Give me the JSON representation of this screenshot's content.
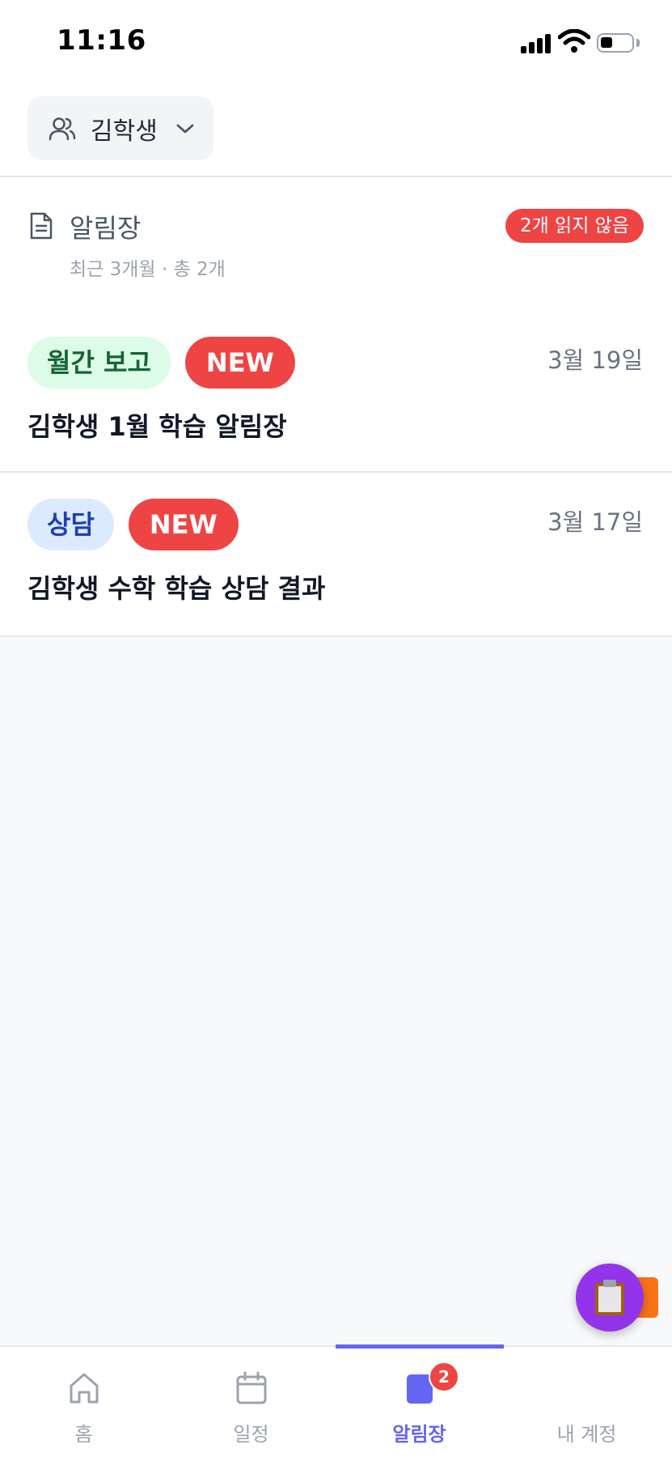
{
  "status_bar": {
    "time": "11:16"
  },
  "student_selector": {
    "name": "김학생"
  },
  "section": {
    "title": "알림장",
    "subtitle": "최근 3개월 · 총 2개",
    "unread_badge": "2개 읽지 않음"
  },
  "notices": [
    {
      "category": "월간 보고",
      "new_label": "NEW",
      "date": "3월 19일",
      "title": "김학생 1월 학습 알림장"
    },
    {
      "category": "상담",
      "new_label": "NEW",
      "date": "3월 17일",
      "title": "김학생 수학 학습 상담 결과"
    }
  ],
  "tab_bar": {
    "tabs": [
      {
        "label": "홈",
        "icon": "home-icon"
      },
      {
        "label": "일정",
        "icon": "calendar-icon"
      },
      {
        "label": "알림장",
        "icon": "notice-icon",
        "badge": "2",
        "active": true
      },
      {
        "label": "내 계정",
        "icon": "account-icon"
      }
    ]
  },
  "colors": {
    "accent": "#6366f1",
    "badge_red": "#ef4444",
    "monthly_tag_bg": "#dcfce7",
    "counsel_tag_bg": "#dbeafe",
    "fab_purple": "#9333ea",
    "fab_indigo": "#4f46e5",
    "fab_orange": "#f97316"
  }
}
